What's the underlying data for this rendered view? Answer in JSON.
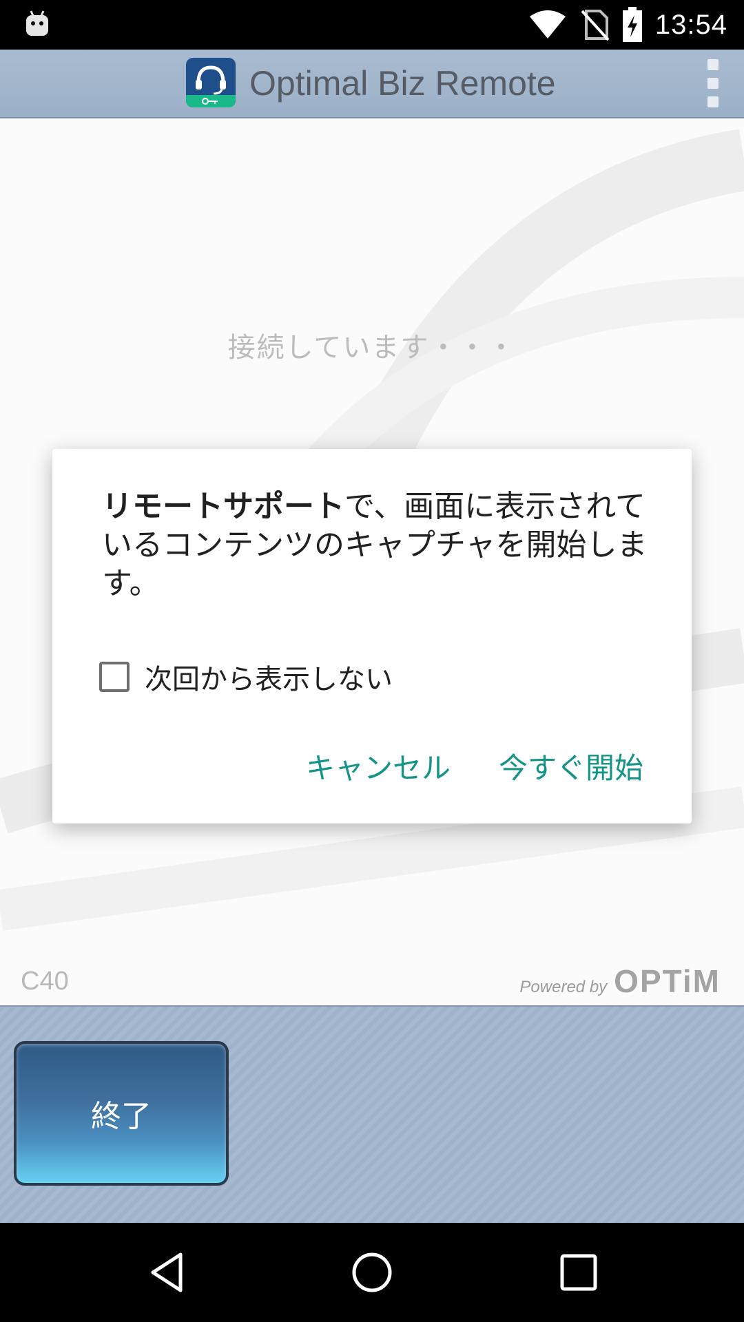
{
  "status_bar": {
    "time": "13:54",
    "icons": [
      "android-icon",
      "wifi-icon",
      "no-sim-icon",
      "battery-charging-icon"
    ]
  },
  "app_bar": {
    "title": "Optimal Biz Remote",
    "logo_icon": "headset-icon",
    "menu_icon": "overflow-menu-icon"
  },
  "content": {
    "status_text": "接続しています・・・",
    "version": "C40",
    "powered_by": {
      "label": "Powered by",
      "brand": "OPTiM"
    }
  },
  "dialog": {
    "message_bold": "リモートサポート",
    "message_rest": "で、画面に表示されているコンテンツのキャプチャを開始します。",
    "checkbox_label": "次回から表示しない",
    "checkbox_checked": false,
    "cancel_label": "キャンセル",
    "start_label": "今すぐ開始",
    "accent_color": "#139487"
  },
  "bottom": {
    "end_label": "終了"
  },
  "nav_bar": {
    "icons": [
      "back-icon",
      "home-icon",
      "recents-icon"
    ]
  }
}
